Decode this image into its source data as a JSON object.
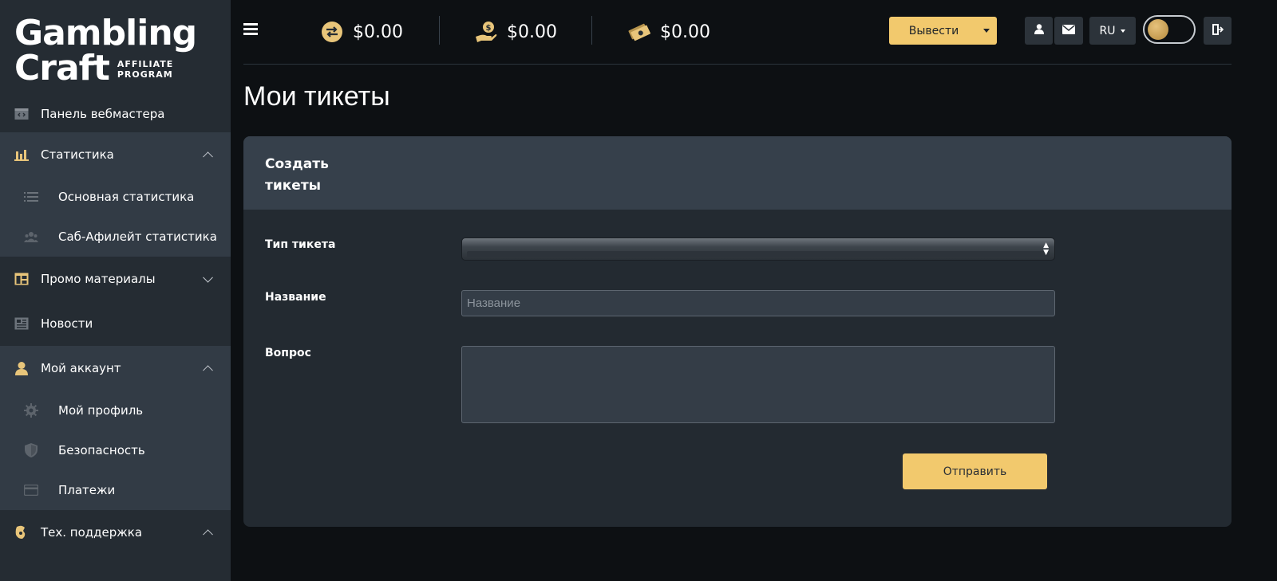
{
  "brand": {
    "line1": "Gambling",
    "line2": "Craft",
    "sub1": "AFFILIATE",
    "sub2": "PROGRAM"
  },
  "sidebar": {
    "items": [
      {
        "label": "Панель вебмастера",
        "icon": "dashboard-icon"
      },
      {
        "label": "Статистика",
        "icon": "bar-chart-icon",
        "expanded": true
      },
      {
        "label": "Основная статистика",
        "icon": "list-icon"
      },
      {
        "label": "Саб-Афилейт статистика",
        "icon": "users-icon"
      },
      {
        "label": "Промо материалы",
        "icon": "layout-icon",
        "expanded": false
      },
      {
        "label": "Новости",
        "icon": "newspaper-icon"
      },
      {
        "label": "Мой аккаунт",
        "icon": "user-icon",
        "expanded": true
      },
      {
        "label": "Мой профиль",
        "icon": "gear-icon"
      },
      {
        "label": "Безопасность",
        "icon": "shield-icon"
      },
      {
        "label": "Платежи",
        "icon": "card-icon"
      },
      {
        "label": "Тех. поддержка",
        "icon": "support-icon",
        "expanded": true
      }
    ]
  },
  "topbar": {
    "balances": [
      {
        "value": "$0.00",
        "icon": "exchange-icon"
      },
      {
        "value": "$0.00",
        "icon": "hand-money-icon"
      },
      {
        "value": "$0.00",
        "icon": "cash-icon"
      }
    ],
    "withdraw_label": "Вывести",
    "language": "RU"
  },
  "page": {
    "title": "Мои тикеты"
  },
  "form": {
    "header": "Создать тикеты",
    "type_label": "Тип тикета",
    "name_label": "Название",
    "name_placeholder": "Название",
    "question_label": "Вопрос",
    "submit_label": "Отправить"
  },
  "colors": {
    "accent": "#f2c96d",
    "sidebar_bg": "#252c33",
    "card_header_bg": "#36404b",
    "page_bg": "#0d1013"
  }
}
